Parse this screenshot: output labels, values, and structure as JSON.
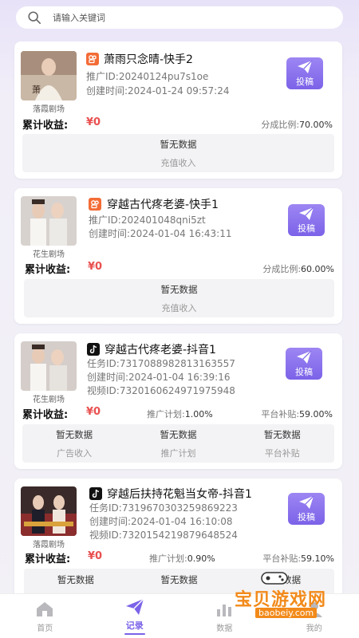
{
  "search": {
    "placeholder": "请输入关键词"
  },
  "cards": [
    {
      "thumb_caption": "落霞剧场",
      "platform": "kuaishou",
      "title": "萧雨只念晴-快手2",
      "lines": [
        "推广ID:20240124pu7s1oe",
        "创建时间:2024-01-24 09:57:24"
      ],
      "submit_label": "投稿",
      "earnings_label": "累计收益:",
      "earnings_value": "¥0",
      "ratio_label": "分成比例:",
      "ratio_value": "70.00%",
      "panel": [
        {
          "title": "暂无数据",
          "sub": "充值收入"
        }
      ]
    },
    {
      "thumb_caption": "花生剧场",
      "platform": "kuaishou",
      "title": "穿越古代疼老婆-快手1",
      "lines": [
        "推广ID:202401048qni5zt",
        "创建时间:2024-01-04 16:43:11"
      ],
      "submit_label": "投稿",
      "earnings_label": "累计收益:",
      "earnings_value": "¥0",
      "ratio_label": "分成比例:",
      "ratio_value": "60.00%",
      "panel": [
        {
          "title": "暂无数据",
          "sub": "充值收入"
        }
      ]
    },
    {
      "thumb_caption": "花生剧场",
      "platform": "douyin",
      "title": "穿越古代疼老婆-抖音1",
      "lines": [
        "任务ID:7317088982813163557",
        "创建时间:2024-01-04 16:39:16",
        "视频ID:7320160624971975948"
      ],
      "submit_label": "投稿",
      "earnings_label": "累计收益:",
      "earnings_value": "¥0",
      "plan_label": "推广计划:",
      "plan_value": "1.00%",
      "subsidy_label": "平台补贴:",
      "subsidy_value": "59.00%",
      "panel": [
        {
          "title": "暂无数据",
          "sub": "广告收入"
        },
        {
          "title": "暂无数据",
          "sub": "推广计划"
        },
        {
          "title": "暂无数据",
          "sub": "平台补贴"
        }
      ]
    },
    {
      "thumb_caption": "落霞剧场",
      "platform": "douyin",
      "title": "穿越后扶持花魁当女帝-抖音1",
      "lines": [
        "任务ID:7319670303259869223",
        "创建时间:2024-01-04 16:10:08",
        "视频ID:7320154219879648524"
      ],
      "submit_label": "投稿",
      "earnings_label": "累计收益:",
      "earnings_value": "¥0",
      "plan_label": "推广计划:",
      "plan_value": "0.90%",
      "subsidy_label": "平台补贴:",
      "subsidy_value": "59.10%",
      "panel": [
        {
          "title": "暂无数据",
          "sub": ""
        },
        {
          "title": "暂无数据",
          "sub": ""
        },
        {
          "title": "暂无数据",
          "sub": ""
        }
      ]
    }
  ],
  "tabs": [
    {
      "label": "首页",
      "icon": "home-icon"
    },
    {
      "label": "记录",
      "icon": "send-icon",
      "active": true
    },
    {
      "label": "数据",
      "icon": "chart-icon"
    },
    {
      "label": "我的",
      "icon": "user-icon"
    }
  ],
  "watermark": {
    "text": "宝贝游戏网",
    "url": "baobeiy.com"
  },
  "colors": {
    "accent": "#7b62e8",
    "money": "#e95050",
    "watermark": "#f28a1a"
  }
}
